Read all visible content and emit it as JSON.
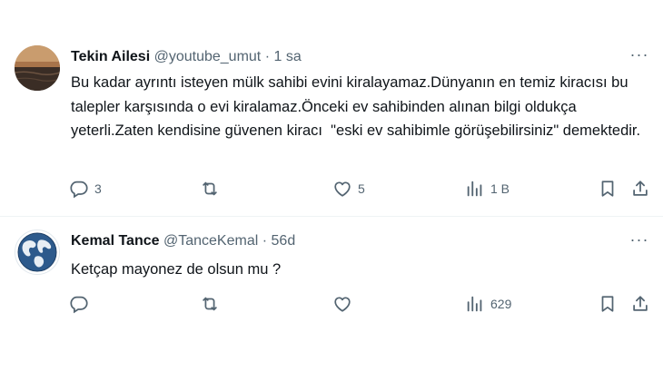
{
  "tweets": [
    {
      "author_name": "Tekin Ailesi",
      "handle": "@youtube_umut",
      "separator": "·",
      "time": "1 sa",
      "more_glyph": "···",
      "text": "Bu kadar ayrıntı isteyen mülk sahibi evini kiralayamaz.Dünyanın en temiz kiracısı bu talepler karşısında o evi kiralamaz.Önceki ev sahibinden alınan bilgi oldukça yeterli.Zaten kendisine güvenen kiracı  \"eski ev sahibimle görüşebilirsiniz\" demektedir.",
      "replies": "3",
      "retweets": "",
      "likes": "5",
      "views": "1 B",
      "avatar": "sunset-photo"
    },
    {
      "author_name": "Kemal Tance",
      "handle": "@TanceKemal",
      "separator": "·",
      "time": "56d",
      "more_glyph": "···",
      "text": "Ketçap mayonez de olsun mu ?",
      "replies": "",
      "retweets": "",
      "likes": "",
      "views": "629",
      "avatar": "globe-icon"
    }
  ],
  "icons": {
    "reply": "reply-icon",
    "retweet": "retweet-icon",
    "like": "heart-icon",
    "views": "views-chart-icon",
    "bookmark": "bookmark-icon",
    "share": "share-icon",
    "more": "more-dots-icon"
  },
  "colors": {
    "text": "#0f1419",
    "secondary": "#536471",
    "divider": "#eff3f4"
  }
}
